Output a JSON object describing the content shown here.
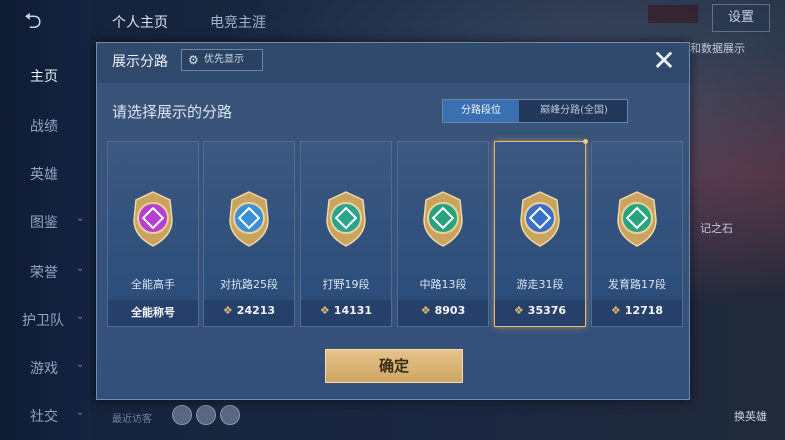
{
  "topnav": {
    "tab1": "个人主页",
    "tab2": "电竞主涯",
    "settings": "设置"
  },
  "sidebar": {
    "items": [
      {
        "label": "主页",
        "active": true
      },
      {
        "label": "战绩"
      },
      {
        "label": "英雄"
      },
      {
        "label": "图鉴"
      },
      {
        "label": "荣誉"
      },
      {
        "label": "护卫队"
      },
      {
        "label": "游戏"
      },
      {
        "label": "社交"
      }
    ]
  },
  "bg_labels": {
    "right1": "和数据展示",
    "right2": "记之石",
    "recent": "最近访客",
    "swap": "换英雄"
  },
  "dialog": {
    "title": "展示分路",
    "priority_label": "优先显示",
    "subtitle": "请选择展示的分路",
    "toggle": {
      "selected": "分路段位",
      "other": "巅峰分路(全国)"
    },
    "cards": [
      {
        "name": "全能高手",
        "score": "全能称号",
        "has_icon": false,
        "color": "#b43fd0"
      },
      {
        "name": "对抗路25段",
        "score": "24213",
        "has_icon": true,
        "color": "#3a8fd6"
      },
      {
        "name": "打野19段",
        "score": "14131",
        "has_icon": true,
        "color": "#2ba48c"
      },
      {
        "name": "中路13段",
        "score": "8903",
        "has_icon": true,
        "color": "#29a07e"
      },
      {
        "name": "游走31段",
        "score": "35376",
        "has_icon": true,
        "color": "#3a6fc7"
      },
      {
        "name": "发育路17段",
        "score": "12718",
        "has_icon": true,
        "color": "#2aa37f"
      }
    ],
    "confirm": "确定"
  }
}
